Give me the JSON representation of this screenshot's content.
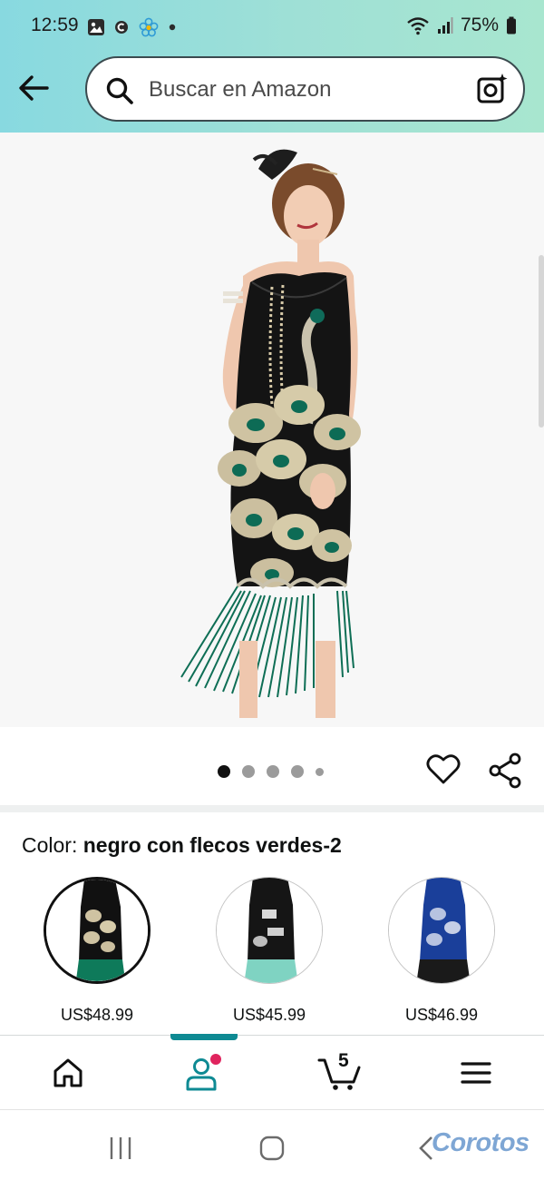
{
  "status_bar": {
    "time": "12:59",
    "battery": "75%",
    "icons": [
      "gallery-icon",
      "notification-c-icon",
      "flower-icon",
      "dot-icon",
      "wifi-icon",
      "signal-icon",
      "battery-icon"
    ]
  },
  "header": {
    "back_icon": "arrow-left-icon",
    "search": {
      "placeholder": "Buscar en Amazon",
      "value": ""
    },
    "camera_icon": "camera-scan-icon"
  },
  "product": {
    "image_alt": "Peacock sequin flapper dress with green fringe",
    "carousel": {
      "total": 5,
      "current": 1
    },
    "actions": [
      "heart-icon",
      "share-icon"
    ]
  },
  "color": {
    "label": "Color:",
    "selected_name": "negro con flecos verdes-2",
    "swatches": [
      {
        "price": "US$48.99",
        "selected": true,
        "dress_color": "#111111",
        "fringe_color": "#0e7a5a"
      },
      {
        "price": "US$45.99",
        "selected": false,
        "dress_color": "#151515",
        "fringe_color": "#7fd3c2"
      },
      {
        "price": "US$46.99",
        "selected": false,
        "dress_color": "#1a3f9a",
        "fringe_color": "#1a1a1a"
      }
    ]
  },
  "bottom_nav": {
    "items": [
      "home-icon",
      "account-icon",
      "cart-icon",
      "menu-icon"
    ],
    "active": "account-icon",
    "cart_count": "5",
    "accent_color": "#0e8a93",
    "badge_color": "#e0245e"
  },
  "system_nav": {
    "watermark": "Corotos"
  }
}
